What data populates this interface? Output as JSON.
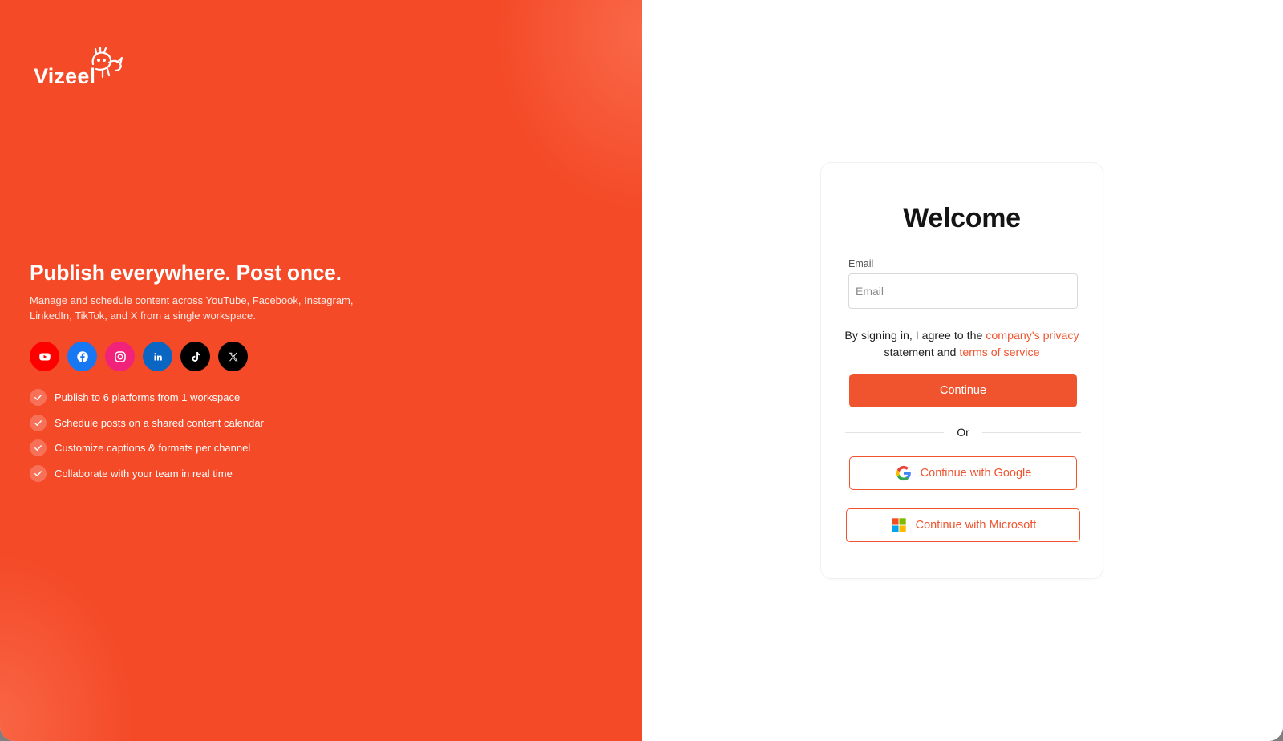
{
  "brand": {
    "name": "Vizeel",
    "accent": "#f44a28",
    "link_color": "#f0542f"
  },
  "hero": {
    "headline": "Publish everywhere. Post once.",
    "subline": "Manage and schedule content across YouTube, Facebook, Instagram, LinkedIn, TikTok, and X from a single workspace."
  },
  "socials": [
    {
      "icon": "youtube-icon",
      "color": "#ff0000"
    },
    {
      "icon": "facebook-icon",
      "color": "#1877f2"
    },
    {
      "icon": "instagram-icon",
      "color": "#f0227a"
    },
    {
      "icon": "linkedin-icon",
      "color": "#0a66c2"
    },
    {
      "icon": "tiktok-icon",
      "color": "#000000"
    },
    {
      "icon": "x-icon",
      "color": "#000000"
    }
  ],
  "features": [
    "Publish to 6 platforms from 1 workspace",
    "Schedule posts on a shared content calendar",
    "Customize captions & formats per channel",
    "Collaborate with your team in real time"
  ],
  "login": {
    "title": "Welcome",
    "email_label": "Email",
    "email_placeholder": "Email",
    "email_value": "",
    "terms_prefix": "By signing in, I agree to the",
    "terms_privacy_link": "company's privacy",
    "terms_middle": "statement and",
    "terms_service_link": "terms of service",
    "continue_label": "Continue",
    "divider_label": "Or",
    "google_label": "Continue with Google",
    "microsoft_label": "Continue with Microsoft"
  }
}
